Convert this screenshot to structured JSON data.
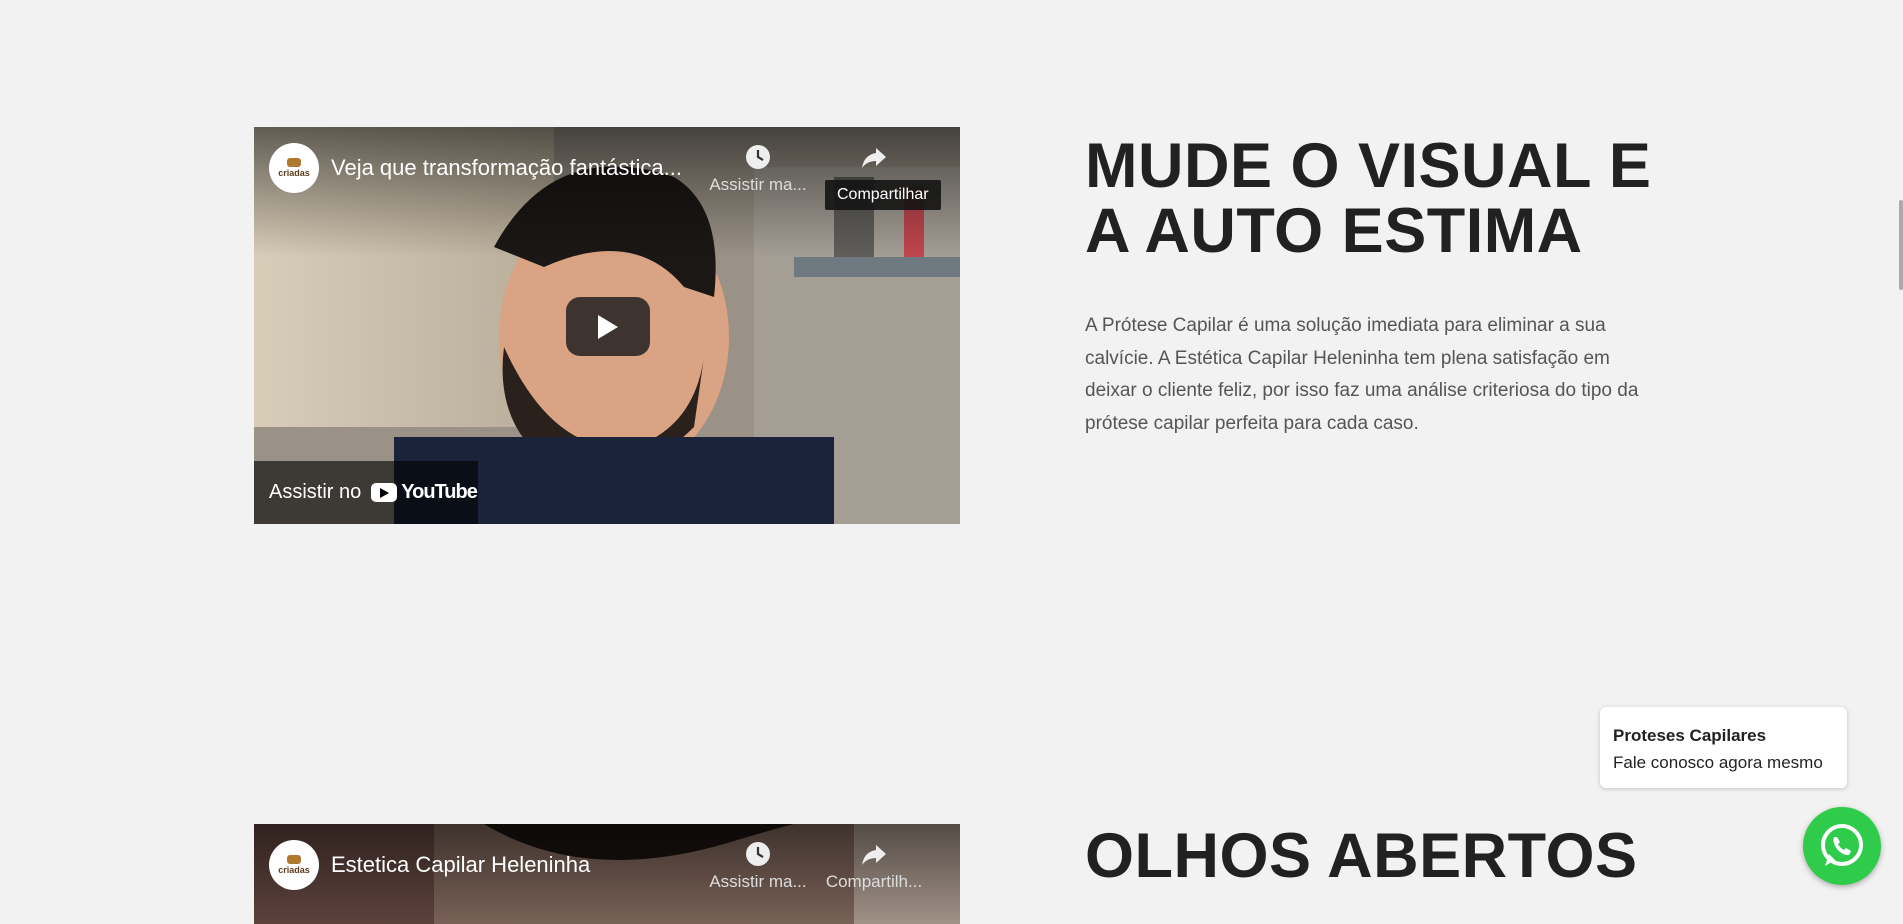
{
  "sections": [
    {
      "video": {
        "title": "Veja que transformação fantástica...",
        "watch_later_label": "Assistir ma...",
        "share_label": "Compartilhar",
        "share_tooltip": "Compartilhar",
        "watch_on_label": "Assistir no",
        "youtube_label": "YouTube"
      },
      "heading_line1": "MUDE O VISUAL E",
      "heading_line2": "A AUTO ESTIMA",
      "paragraph": "A Prótese Capilar é uma solução imediata para eliminar a sua calvície. A Estética Capilar Heleninha tem plena satisfação em deixar o cliente feliz, por isso faz uma análise criteriosa do tipo da prótese capilar perfeita para cada caso."
    },
    {
      "video": {
        "title": "Estetica Capilar Heleninha",
        "watch_later_label": "Assistir ma...",
        "share_label": "Compartilh..."
      },
      "heading_line1": "OLHOS ABERTOS"
    }
  ],
  "channel_logo_text": "criadas",
  "chat": {
    "name": "Proteses Capilares",
    "message": "Fale conosco agora mesmo"
  },
  "colors": {
    "background": "#f2f2f2",
    "heading": "#212121",
    "paragraph": "#555555",
    "whatsapp": "#2ecc4a"
  },
  "icons": [
    "clock-icon",
    "share-icon",
    "play-icon",
    "youtube-icon",
    "whatsapp-icon"
  ]
}
